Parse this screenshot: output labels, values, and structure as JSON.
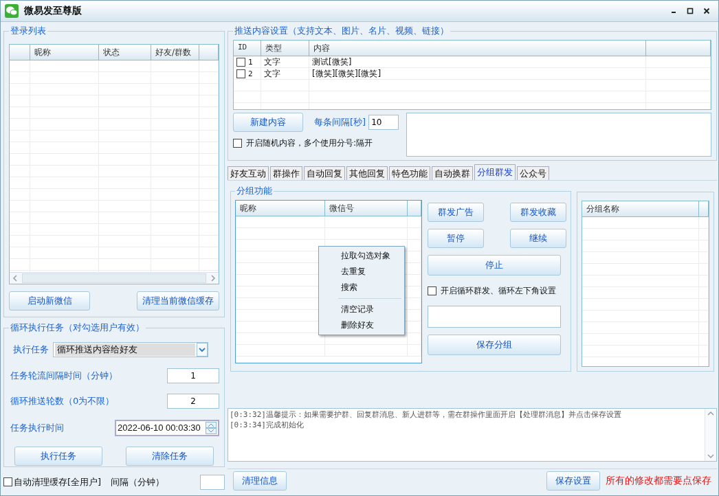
{
  "window": {
    "title": "微易发至尊版"
  },
  "login_list": {
    "title": "登录列表",
    "columns": [
      "昵称",
      "状态",
      "好友/群数"
    ],
    "buttons": [
      "启动新微信",
      "清理当前微信缓存"
    ]
  },
  "loop_task": {
    "title": "循环执行任务（对勾选用户有效）",
    "task_label": "执行任务",
    "task_value": "循环推送内容给好友",
    "interval_label": "任务轮流间隔时间（分钟）",
    "interval_value": "1",
    "rounds_label": "循环推送轮数（0为不限）",
    "rounds_value": "2",
    "time_label": "任务执行时间",
    "time_value": "2022-06-10 00:03:30",
    "buttons": [
      "执行任务",
      "清除任务"
    ]
  },
  "auto_clean": {
    "label": "自动清理缓存[全用户]",
    "checked": false,
    "interval_label": "间隔（分钟）"
  },
  "push_content": {
    "title": "推送内容设置（支持文本、图片、名片、视频、链接）",
    "columns": [
      "ID",
      "类型",
      "内容"
    ],
    "rows": [
      {
        "checked": false,
        "id": "1",
        "type": "文字",
        "content": "测试[微笑]"
      },
      {
        "checked": false,
        "id": "2",
        "type": "文字",
        "content": "[微笑][微笑][微笑]"
      }
    ],
    "new_button": "新建内容",
    "interval_label": "每条间隔[秒]",
    "interval_value": "10",
    "random": {
      "label": "开启随机内容，多个使用分号:隔开",
      "checked": false
    }
  },
  "tabs": [
    {
      "label": "好友互动",
      "selected": false
    },
    {
      "label": "群操作",
      "selected": false
    },
    {
      "label": "自动回复",
      "selected": false
    },
    {
      "label": "其他回复",
      "selected": false
    },
    {
      "label": "特色功能",
      "selected": false
    },
    {
      "label": "自动换群",
      "selected": false
    },
    {
      "label": "分组群发",
      "selected": true
    },
    {
      "label": "公众号",
      "selected": false
    }
  ],
  "group_panel": {
    "title": "分组功能",
    "columns": [
      "昵称",
      "微信号"
    ],
    "buttons": [
      "群发广告",
      "群发收藏",
      "暂停",
      "继续"
    ],
    "stop_button": "停止",
    "loop": {
      "label": "开启循环群发、循环左下角设置",
      "checked": false
    },
    "save_button": "保存分组",
    "group_columns": [
      "分组名称"
    ]
  },
  "context_menu": {
    "sections": [
      [
        "拉取勾选对象",
        "去重复",
        "搜索"
      ],
      [
        "清空记录",
        "删除好友"
      ]
    ]
  },
  "log": [
    "[0:3:32]温馨提示：如果需要护群、回复群消息、新人进群等，需在群操作里面开启【处理群消息】并点击保存设置",
    "[0:3:34]完成初始化"
  ],
  "bottom": {
    "clear_button": "清理信息",
    "save_button": "保存设置",
    "notice": "所有的修改都需要点保存"
  }
}
